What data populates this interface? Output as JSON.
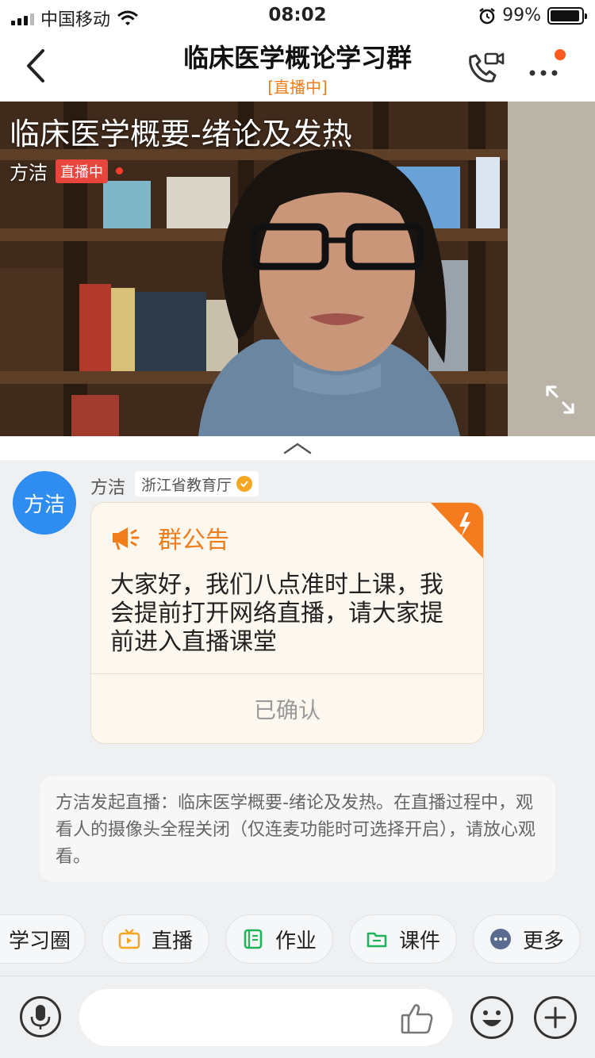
{
  "status_bar": {
    "carrier": "中国移动",
    "time": "08:02",
    "battery": "99%",
    "icons": [
      "signal-icon",
      "wifi-icon",
      "alarm-icon",
      "battery-icon"
    ]
  },
  "header": {
    "title": "临床医学概论学习群",
    "subtitle": "[直播中]",
    "icons": [
      "back-icon",
      "video-call-icon",
      "more-icon"
    ],
    "accent_color": "#f07d1b",
    "badge_color": "#ff5a1f"
  },
  "video": {
    "title": "临床医学概要-绪论及发热",
    "host": "方洁",
    "live_badge": "直播中",
    "icons": [
      "fullscreen-icon"
    ],
    "live_color": "#e8453c"
  },
  "chat": {
    "avatar_text": "方洁",
    "sender_name": "方洁",
    "sender_org": "浙江省教育厅",
    "notice": {
      "title": "群公告",
      "body": "大家好，我们八点准时上课，我会提前打开网络直播，请大家提前进入直播课堂",
      "confirm": "已确认",
      "icons": [
        "megaphone-icon",
        "lightning-icon"
      ]
    },
    "system_message": "方洁发起直播：临床医学概要-绪论及发热。在直播过程中，观看人的摄像头全程关闭（仅连麦功能时可选择开启），请放心观看。"
  },
  "quick_actions": [
    {
      "label": "学习圈",
      "icon": ""
    },
    {
      "label": "直播",
      "icon": "live-tv-icon"
    },
    {
      "label": "作业",
      "icon": "homework-icon"
    },
    {
      "label": "课件",
      "icon": "folder-icon"
    },
    {
      "label": "更多",
      "icon": "more-dots-icon"
    }
  ],
  "input_bar": {
    "placeholder": "",
    "icons": [
      "microphone-icon",
      "thumbs-up-icon",
      "emoji-icon",
      "plus-icon"
    ]
  }
}
